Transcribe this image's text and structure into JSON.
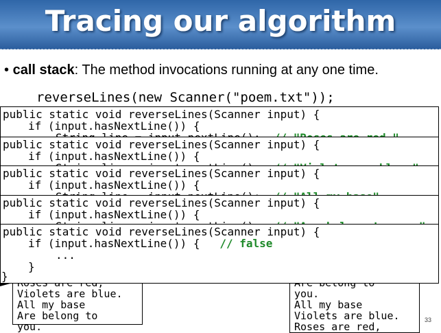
{
  "slide": {
    "title": "Tracing our algorithm",
    "bullet_term": "call stack",
    "bullet_text": ": The method invocations running at any one time.",
    "bullet_symbol": "•",
    "call_line": "reverseLines(new Scanner(\"poem.txt\"));",
    "page_number": "33"
  },
  "frames": [
    {
      "signature": "public static void reverseLines(Scanner input) {",
      "if_line": "if (input.hasNextLine()) {",
      "string_line": "String line = input.nextLine();",
      "comment": "// \"Roses are red,\""
    },
    {
      "signature": "public static void reverseLines(Scanner input) {",
      "if_line": "if (input.hasNextLine()) {",
      "string_line": "String line = input.nextLine();",
      "comment": "// \"Violets are blue.\""
    },
    {
      "signature": "public static void reverseLines(Scanner input) {",
      "if_line": "if (input.hasNextLine()) {",
      "string_line": "String line = input.nextLine();",
      "comment": "// \"All my base\""
    },
    {
      "signature": "public static void reverseLines(Scanner input) {",
      "if_line": "if (input.hasNextLine()) {",
      "string_line": "String line = input.nextLine();",
      "comment": "// \"Are belong to you.\""
    },
    {
      "signature": "public static void reverseLines(Scanner input) {",
      "if_line": "if (input.hasNextLine()) {",
      "comment": "// false",
      "ellipsis": "...",
      "close_brace": "}"
    }
  ],
  "closing_brace": "}",
  "input_file": [
    "Roses are red,",
    "Violets are blue.",
    "All my base",
    "Are belong to",
    "you."
  ],
  "output": [
    "Are belong to",
    "you.",
    "All my base",
    "Violets are blue.",
    "Roses are red,"
  ]
}
